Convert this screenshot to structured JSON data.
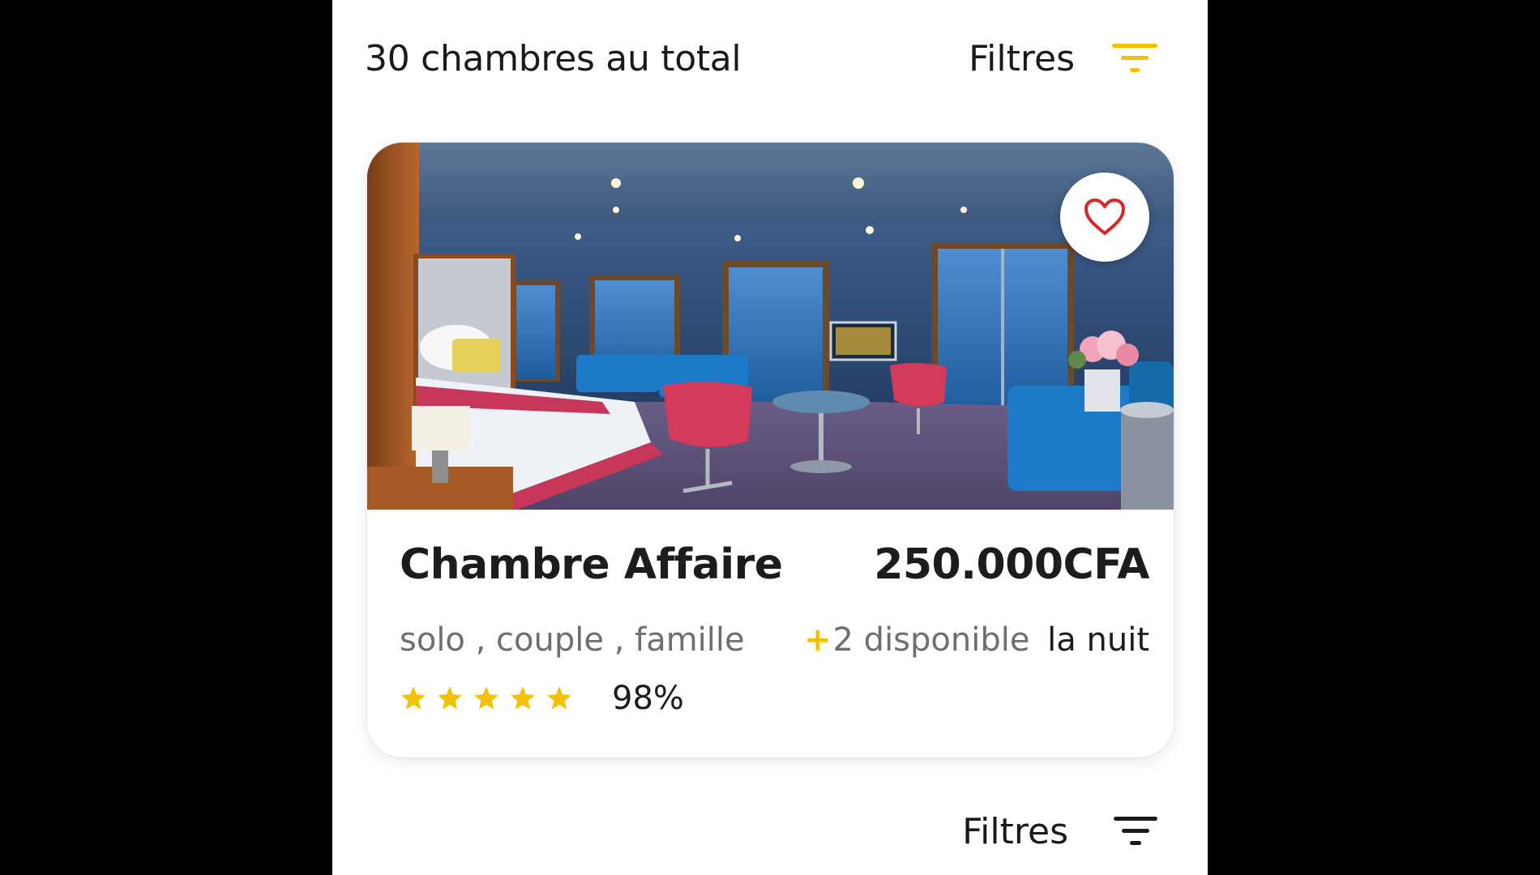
{
  "header": {
    "total_label": "30 chambres au total",
    "filter_label": "Filtres",
    "filter_icon": "filter-lines-icon",
    "filter_icon_color": "#f2c200"
  },
  "room_card": {
    "image": "cruise-suite-photo",
    "favorite_icon": "heart-outline-icon",
    "favorite_color": "#d62828",
    "name": "Chambre Affaire",
    "price": "250.000CFA",
    "tags": "solo , couple , famille",
    "availability_plus": "+",
    "availability_text": "2 disponible",
    "price_unit": "la nuit",
    "rating": {
      "stars": 5,
      "star_color": "#f2c200",
      "percent": "98%"
    }
  },
  "footer_bar": {
    "filter_label": "Filtres",
    "filter_icon": "filter-lines-icon",
    "filter_icon_color": "#1a1a1a"
  }
}
